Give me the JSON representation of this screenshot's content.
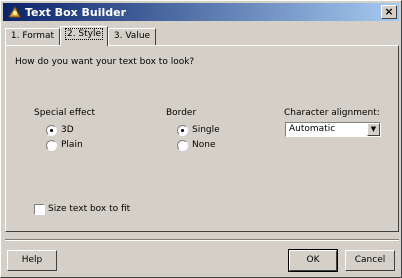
{
  "window": {
    "title": "Text Box Builder",
    "close_glyph": "×"
  },
  "tabs": [
    {
      "label": "1. Format"
    },
    {
      "label": "2. Style"
    },
    {
      "label": "3. Value"
    }
  ],
  "panel": {
    "prompt": "How do you want your text box to look?",
    "special_effect": {
      "label": "Special effect",
      "options": [
        "3D",
        "Plain"
      ],
      "selected": "3D"
    },
    "border": {
      "label": "Border",
      "options": [
        "Single",
        "None"
      ],
      "selected": "Single"
    },
    "alignment": {
      "label": "Character alignment:",
      "value": "Automatic"
    },
    "size_to_fit": {
      "label": "Size text box to fit",
      "checked": false
    }
  },
  "buttons": {
    "help": "Help",
    "ok": "OK",
    "cancel": "Cancel"
  },
  "icons": {
    "title": "builder-wand-icon",
    "dropdown": "chevron-down-icon"
  }
}
